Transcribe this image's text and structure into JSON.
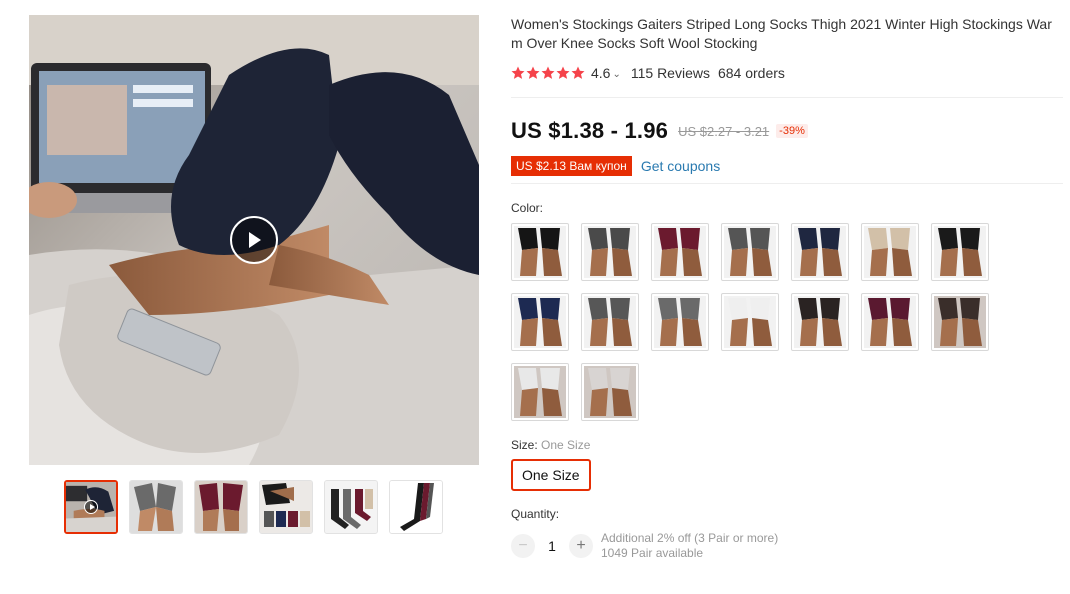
{
  "product": {
    "title": "Women's Stockings Gaiters Striped Long Socks Thigh 2021 Winter High Stockings Warm Over Knee Socks Soft Wool Stocking",
    "rating": "4.6",
    "rating_stars": 5,
    "reviews": "115 Reviews",
    "orders": "684 orders"
  },
  "price": {
    "current": "US $1.38 - 1.96",
    "original": "US $2.27 - 3.21",
    "discount": "-39%"
  },
  "coupon": {
    "badge": "US $2.13 Вам купон",
    "link": "Get coupons"
  },
  "color": {
    "label": "Color:",
    "swatch_colors": [
      "#151515",
      "#4a4a4a",
      "#6b1a2e",
      "#555555",
      "#1f2740",
      "#d2c0a8",
      "#1a1a1a",
      "#1d2a52",
      "#575757",
      "#6a6a6a",
      "#efefef",
      "#2a2322",
      "#5a1930",
      "#3a2e2a",
      "#e8e8e8",
      "#d8d4d2"
    ]
  },
  "size": {
    "label": "Size:",
    "selected": "One Size",
    "option": "One Size"
  },
  "quantity": {
    "label": "Quantity:",
    "value": "1",
    "minus": "−",
    "plus": "+",
    "promo": "Additional 2% off (3 Pair or more)",
    "available": "1049 Pair available"
  },
  "gallery": {
    "thumb_count": 6,
    "active_thumb": 0,
    "accent_color": "#e62e04"
  }
}
